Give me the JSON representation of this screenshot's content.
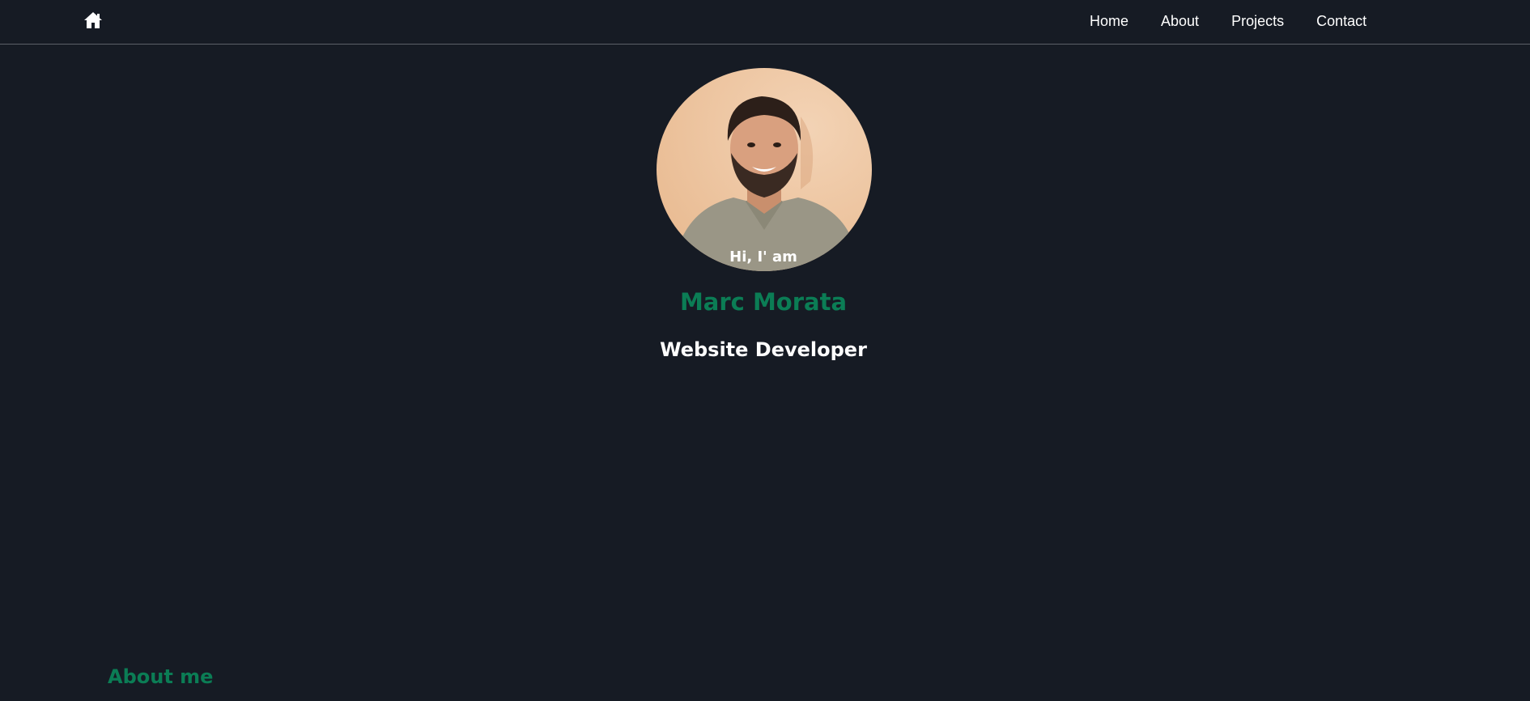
{
  "nav": {
    "home_icon": "home-icon",
    "links": [
      {
        "label": "Home"
      },
      {
        "label": "About"
      },
      {
        "label": "Projects"
      },
      {
        "label": "Contact"
      }
    ]
  },
  "hero": {
    "greeting": "Hi, I' am",
    "name": "Marc Morata",
    "role": "Website Developer"
  },
  "about": {
    "heading": "About me"
  },
  "colors": {
    "background": "#161b24",
    "accent": "#0b7d55",
    "text": "#ffffff"
  }
}
